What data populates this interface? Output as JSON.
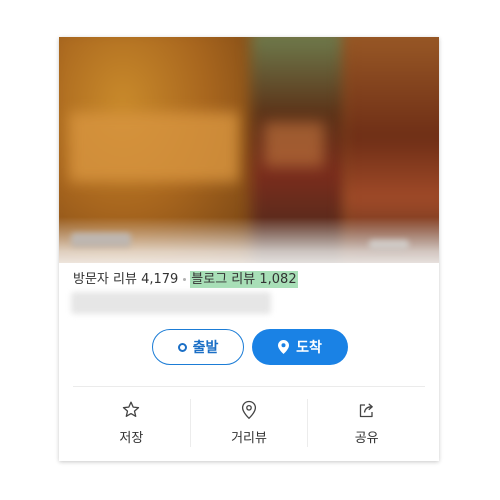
{
  "reviews": {
    "visitor_label": "방문자 리뷰",
    "visitor_count": "4,179",
    "blog_label": "블로그 리뷰",
    "blog_count": "1,082"
  },
  "buttons": {
    "start": "출발",
    "arrive": "도착"
  },
  "actions": [
    {
      "label": "저장",
      "icon": "star-icon"
    },
    {
      "label": "거리뷰",
      "icon": "map-pin-outline-icon"
    },
    {
      "label": "공유",
      "icon": "share-icon"
    }
  ],
  "colors": {
    "accent_blue": "#1a82e5",
    "blog_highlight": "#a8dfb7"
  }
}
